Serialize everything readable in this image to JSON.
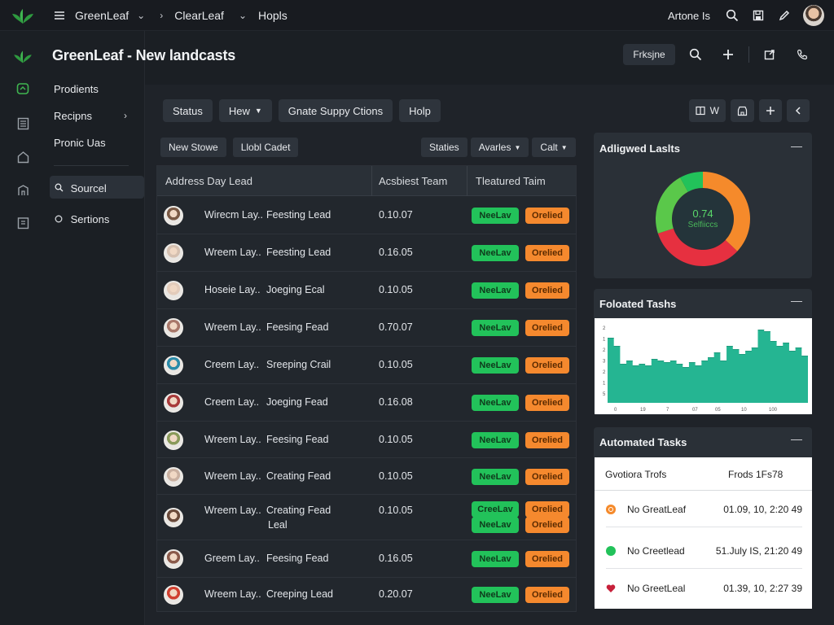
{
  "topbar": {
    "crumbs": [
      "GreenLeaf",
      "ClearLeaf",
      "Hopls"
    ],
    "user": "Artone Is"
  },
  "app": {
    "title": "GreenLeaf  -  New landcasts"
  },
  "header_actions": {
    "primary": "Frksjne"
  },
  "sidebar": {
    "items": [
      {
        "label": "Prodients",
        "chev": false
      },
      {
        "label": "Recipns",
        "chev": true
      },
      {
        "label": "Pronic Uas",
        "chev": false
      },
      {
        "label": "Sourcel",
        "chev": false,
        "active": true
      },
      {
        "label": "Sertions",
        "chev": false
      }
    ]
  },
  "toolbar1": [
    "Status",
    "Hew",
    "Gnate Suppy Ctions",
    "Holp"
  ],
  "toolbar1_icons": [
    "W"
  ],
  "toolbar2": [
    "New Stowe",
    "Llobl Cadet"
  ],
  "toolbar2_right": [
    "Staties",
    "Avarles",
    "Calt"
  ],
  "table": {
    "headers": [
      "Address Day Lead",
      "Acsbiest Team",
      "Tleatured Taim"
    ],
    "rows": [
      {
        "name": "Wirecm Lay..",
        "name2": "Feesting Lead",
        "value": "0.10.07",
        "green": "NeeLav",
        "orange": "Orelied",
        "avatar": "#7a5a45"
      },
      {
        "name": "Wreem Lay..",
        "name2": "Feesting Lead",
        "value": "0.16.05",
        "green": "NeeLav",
        "orange": "Orelied",
        "avatar": "#d5c0b0"
      },
      {
        "name": "Hoseie Lay..",
        "name2": "Joeging Ecal",
        "value": "0.10.05",
        "green": "NeeLav",
        "orange": "Orelied",
        "avatar": "#e3ccbb"
      },
      {
        "name": "Wreem Lay..",
        "name2": "Feesing Fead",
        "value": "0.70.07",
        "green": "NeeLav",
        "orange": "Orelied",
        "avatar": "#a8786a"
      },
      {
        "name": "Creem Lay..",
        "name2": "Sreeping Crail",
        "value": "0.10.05",
        "green": "NeeLav",
        "orange": "Orelied",
        "avatar": "#2a8aa8"
      },
      {
        "name": "Creem Lay..",
        "name2": "Joeging Fead",
        "value": "0.16.08",
        "green": "NeeLav",
        "orange": "Orelied",
        "avatar": "#a83a3a"
      },
      {
        "name": "Wreem Lay..",
        "name2": "Feesing Fead",
        "value": "0.10.05",
        "green": "NeeLav",
        "orange": "Orelied",
        "avatar": "#8a9a5a"
      },
      {
        "name": "Wreem Lay..",
        "name2": "Creating Fead",
        "value": "0.10.05",
        "green": "NeeLav",
        "orange": "Orelied",
        "avatar": "#c9b0a0"
      },
      {
        "name": "Wreem Lay..",
        "name2": "Creating Fead",
        "name3": "Leal",
        "value": "0.10.05",
        "green": "CreeLav",
        "orange": "Orelied",
        "green2": "NeeLav",
        "orange2": "Orelied",
        "avatar": "#6a4a3a"
      },
      {
        "name": "Greem Lay..",
        "name2": "Feesing Fead",
        "value": "0.16.05",
        "green": "NeeLav",
        "orange": "Orelied",
        "avatar": "#8a5a4a"
      },
      {
        "name": "Wreem Lay..",
        "name2": "Creeping Lead",
        "value": "0.20.07",
        "green": "NeeLav",
        "orange": "Orelied",
        "avatar": "#d04030"
      }
    ]
  },
  "cards": {
    "donut": {
      "title": "Adligwed Laslts",
      "value": "0.74",
      "label": "Selfiiccs"
    },
    "area": {
      "title": "Foloated Tashs",
      "x_ticks": [
        "0",
        "19",
        "7",
        "07",
        "05",
        "10",
        "100"
      ],
      "y_ticks": [
        "2",
        "1",
        "2",
        "3",
        "2",
        "1",
        "5"
      ]
    },
    "tasks": {
      "title": "Automated Tasks",
      "headers": [
        "Gvotiora Trofs",
        "Frods 1Fs78"
      ],
      "rows": [
        {
          "label": "No GreatLeaf",
          "time": "01.09, 10, 2:20 49",
          "color": "#f58a2b"
        },
        {
          "label": "No Creetlead",
          "time": "51.July IS, 21:20 49",
          "color": "#22c25a"
        },
        {
          "label": "No GreetLeal",
          "time": "01.39, 10, 2:27 39",
          "color": "#c7203a"
        }
      ]
    }
  },
  "chart_data": {
    "type": "area",
    "title": "Foloated Tashs",
    "series": [
      {
        "values": [
          4.0,
          3.5,
          2.4,
          2.6,
          2.3,
          2.4,
          2.3,
          2.7,
          2.6,
          2.5,
          2.6,
          2.4,
          2.2,
          2.5,
          2.3,
          2.6,
          2.8,
          3.1,
          2.6,
          3.5,
          3.3,
          3.0,
          3.2,
          3.4,
          4.5,
          4.4,
          3.8,
          3.5,
          3.7,
          3.2,
          3.4,
          2.9
        ]
      }
    ],
    "ylim": [
      0,
      5
    ]
  },
  "donut_data": {
    "type": "pie",
    "values": [
      0.37,
      0.33,
      0.22,
      0.08
    ],
    "colors": [
      "#f58a2b",
      "#e63040",
      "#5ac84a",
      "#22c25a"
    ]
  }
}
